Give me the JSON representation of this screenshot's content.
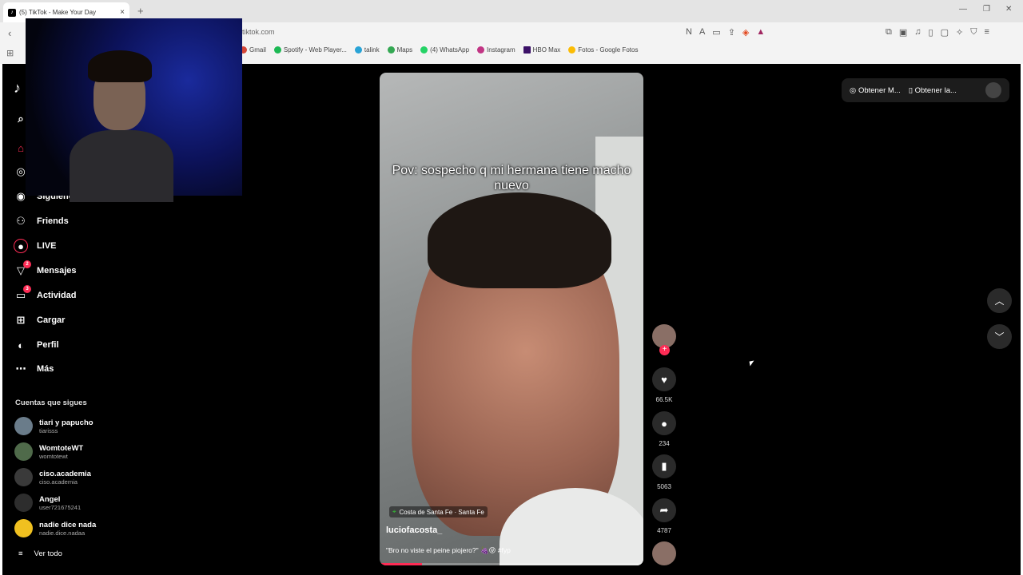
{
  "browser": {
    "tab_title": "(5) TikTok - Make Your Day",
    "url": "tiktok.com",
    "bookmarks": [
      "Gmail",
      "Spotify - Web Player...",
      "talink",
      "Maps",
      "(4) WhatsApp",
      "Instagram",
      "HBO Max",
      "Fotos - Google Fotos"
    ]
  },
  "sidebar": {
    "items": [
      {
        "label": "Siguiendo",
        "icon": "following-icon"
      },
      {
        "label": "Friends",
        "icon": "friends-icon"
      },
      {
        "label": "LIVE",
        "icon": "live-icon"
      },
      {
        "label": "Mensajes",
        "icon": "messages-icon",
        "badge": "2"
      },
      {
        "label": "Actividad",
        "icon": "activity-icon",
        "badge": "3"
      },
      {
        "label": "Cargar",
        "icon": "upload-icon"
      },
      {
        "label": "Perfil",
        "icon": "profile-icon"
      },
      {
        "label": "Más",
        "icon": "more-icon"
      }
    ],
    "following_title": "Cuentas que sigues",
    "following": [
      {
        "name": "tiari y papucho",
        "handle": "tiarisss"
      },
      {
        "name": "WomtoteWT",
        "handle": "womtotewt"
      },
      {
        "name": "ciso.academia",
        "handle": "ciso.academia"
      },
      {
        "name": "Angel",
        "handle": "user721675241"
      },
      {
        "name": "nadie dice nada",
        "handle": "nadie.dice.nadaa"
      }
    ],
    "see_all": "Ver todo"
  },
  "video": {
    "caption": "Pov: sospecho q mi hermana tiene macho nuevo",
    "location": "Costa de Santa Fe · Santa Fe",
    "author": "luciofacosta_",
    "description": "\"Bro no viste el peine piojero?\" 🍇😝 #fyp",
    "progress": 0.16
  },
  "actions": {
    "likes": "66.5K",
    "comments": "234",
    "saves": "5063",
    "shares": "4787"
  },
  "top": {
    "get_coins": "Obtener M...",
    "get_app": "Obtener la..."
  },
  "colors": {
    "accent": "#fe2c55",
    "bg": "#000000"
  }
}
